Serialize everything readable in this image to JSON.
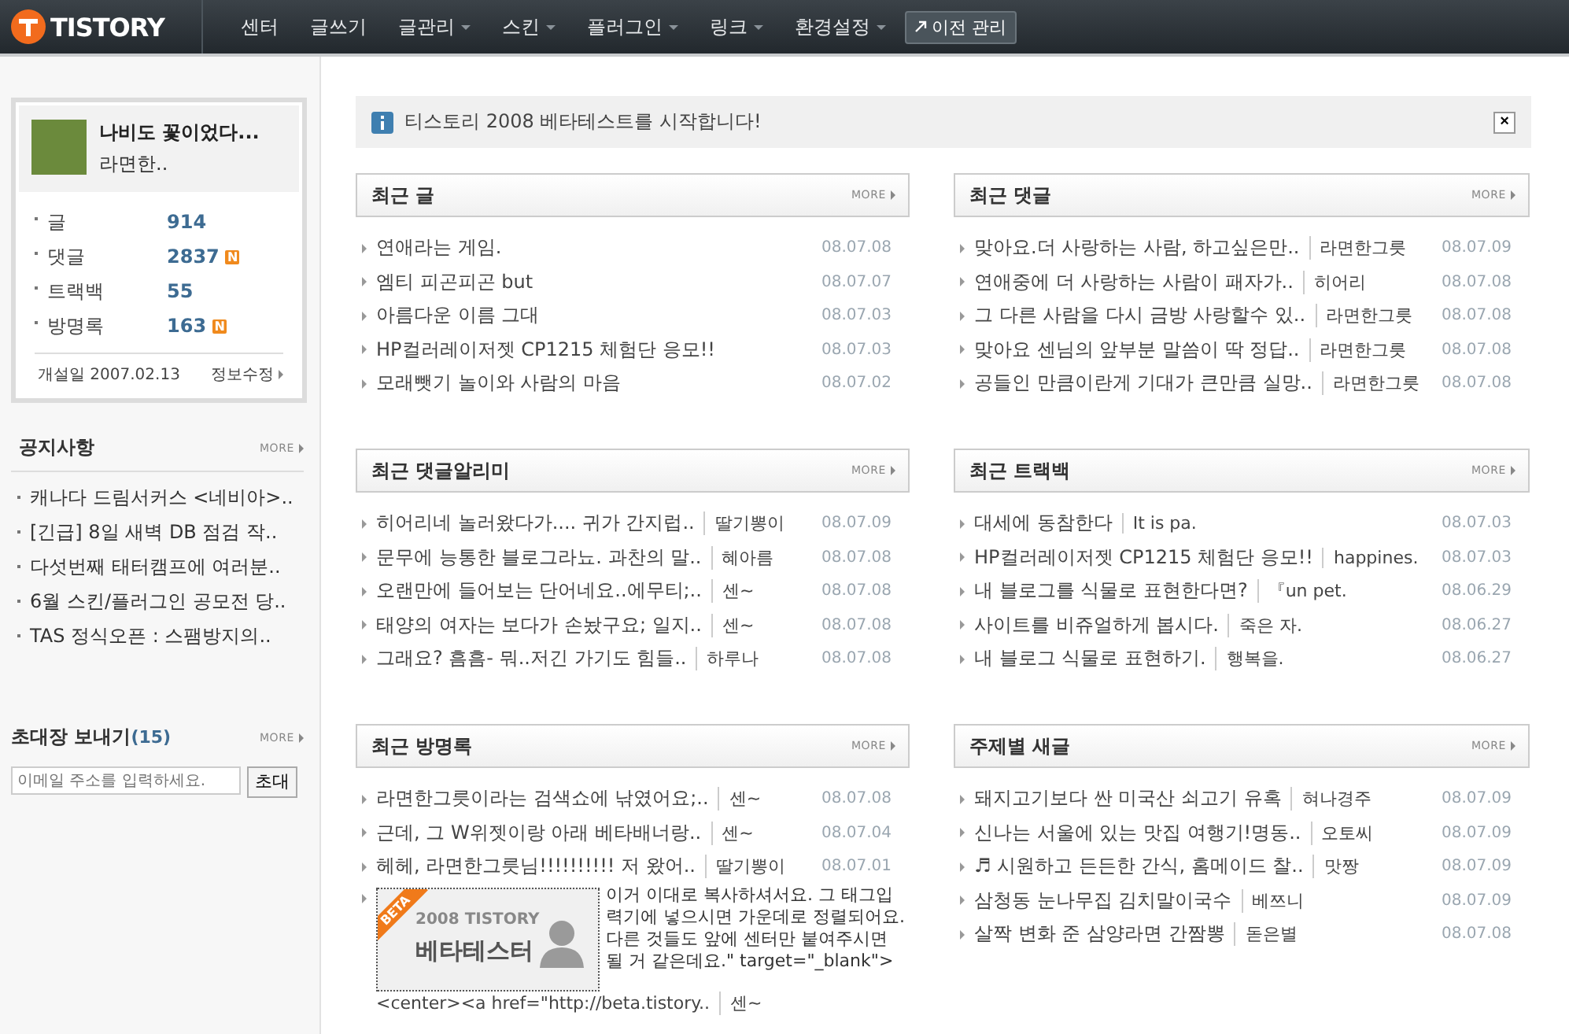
{
  "topbar": {
    "logo": "TISTORY",
    "nav": [
      {
        "label": "센터",
        "dropdown": false
      },
      {
        "label": "글쓰기",
        "dropdown": false
      },
      {
        "label": "글관리",
        "dropdown": true
      },
      {
        "label": "스킨",
        "dropdown": true
      },
      {
        "label": "플러그인",
        "dropdown": true
      },
      {
        "label": "링크",
        "dropdown": true
      },
      {
        "label": "환경설정",
        "dropdown": true
      }
    ],
    "old_admin_button": "이전 관리"
  },
  "sidebar": {
    "profile": {
      "title": "나비도 꽃이었다...",
      "name": "라면한..",
      "stats": [
        {
          "label": "글",
          "value": "914"
        },
        {
          "label": "댓글",
          "value": "2837",
          "badge": "N"
        },
        {
          "label": "트랙백",
          "value": "55"
        },
        {
          "label": "방명록",
          "value": "163",
          "badge": "N"
        }
      ],
      "opened": "개설일 2007.02.13",
      "edit_link": "정보수정"
    },
    "notices": {
      "title": "공지사항",
      "more": "MORE",
      "items": [
        "캐나다 드림서커스 <네비아>..",
        "[긴급] 8일 새벽 DB 점검 작..",
        "다섯번째 태터캠프에 여러분..",
        "6월 스킨/플러그인 공모전 당..",
        "TAS 정식오픈 : 스팸방지의.."
      ]
    },
    "invite": {
      "title": "초대장 보내기",
      "count": "(15)",
      "more": "MORE",
      "placeholder": "이메일 주소를 입력하세요.",
      "button": "초대"
    }
  },
  "notice_bar": {
    "text": "티스토리 2008 베타테스트를 시작합니다!",
    "close": "×"
  },
  "panels": [
    {
      "title": "최근 글",
      "more": "MORE",
      "rows": [
        {
          "kind": "plain",
          "text": "연애라는 게임.",
          "date": "08.07.08"
        },
        {
          "kind": "plain",
          "text": "엠티 피곤피곤 but",
          "date": "08.07.07"
        },
        {
          "kind": "plain",
          "text": "아름다운 이름 그대",
          "date": "08.07.03"
        },
        {
          "kind": "plain",
          "text": "HP컬러레이저젯 CP1215 체험단 응모!!",
          "date": "08.07.03"
        },
        {
          "kind": "plain",
          "text": "모래뺏기 놀이와 사람의 마음",
          "date": "08.07.02"
        }
      ]
    },
    {
      "title": "최근 댓글",
      "more": "MORE",
      "rows": [
        {
          "kind": "plain",
          "text": "맞아요.더 사랑하는 사람, 하고싶은만..",
          "author": "라면한그릇",
          "date": "08.07.09"
        },
        {
          "kind": "plain",
          "text": "연애중에 더 사랑하는 사람이 패자가..",
          "author": "히어리",
          "date": "08.07.08"
        },
        {
          "kind": "plain",
          "text": "그 다른 사람을 다시 금방 사랑할수 있..",
          "author": "라면한그릇",
          "date": "08.07.08"
        },
        {
          "kind": "plain",
          "text": "맞아요 센님의 앞부분 말씀이 딱 정답..",
          "author": "라면한그릇",
          "date": "08.07.08"
        },
        {
          "kind": "plain",
          "text": "공들인 만큼이란게 기대가 큰만큼 실망..",
          "author": "라면한그릇",
          "date": "08.07.08"
        }
      ]
    },
    {
      "title": "최근 댓글알리미",
      "more": "MORE",
      "rows": [
        {
          "kind": "plain",
          "text": "히어리네 놀러왔다가.... 귀가 간지럽..",
          "author": "딸기뽕이",
          "date": "08.07.09"
        },
        {
          "kind": "plain",
          "text": "문무에 능통한 블로그라뇨. 과찬의 말..",
          "author": "혜아름",
          "date": "08.07.08"
        },
        {
          "kind": "plain",
          "text": "오랜만에 들어보는 단어네요..에무티;..",
          "author": "센~",
          "date": "08.07.08"
        },
        {
          "kind": "plain",
          "text": "태양의 여자는 보다가 손놨구요; 일지..",
          "author": "센~",
          "date": "08.07.08"
        },
        {
          "kind": "plain",
          "text": "그래요? 흠흠- 뭐..저긴 가기도 힘들..",
          "author": "하루나",
          "date": "08.07.08"
        }
      ]
    },
    {
      "title": "최근 트랙백",
      "more": "MORE",
      "rows": [
        {
          "kind": "plain",
          "text": "대세에 동참한다",
          "author": "It is pa.",
          "date": "08.07.03"
        },
        {
          "kind": "plain",
          "text": "HP컬러레이저젯 CP1215 체험단 응모!!",
          "author": "happines.",
          "date": "08.07.03"
        },
        {
          "kind": "plain",
          "text": "내 블로그를 식물로 표현한다면?",
          "author": "『un pet.",
          "date": "08.06.29"
        },
        {
          "kind": "plain",
          "text": "사이트를 비쥬얼하게 봅시다.",
          "author": "죽은 자.",
          "date": "08.06.27"
        },
        {
          "kind": "plain",
          "text": "내 블로그 식물로 표현하기.",
          "author": "행복을.",
          "date": "08.06.27"
        }
      ]
    },
    {
      "title": "최근 방명록",
      "more": "MORE",
      "rows": [
        {
          "kind": "plain",
          "text": "라면한그릇이라는 검색쇼에 낚였어요;..",
          "author": "센~",
          "date": "08.07.08"
        },
        {
          "kind": "plain",
          "text": "근데, 그 W위젯이랑 아래 베타배너랑..",
          "author": "센~",
          "date": "08.07.04"
        },
        {
          "kind": "plain",
          "text": "헤헤, 라면한그릇님!!!!!!!!!! 저 왔어..",
          "author": "딸기뽕이",
          "date": "08.07.01"
        },
        {
          "kind": "banner",
          "banner": {
            "ribbon": "BETA",
            "line1": "2008 TISTORY",
            "line2": "베타테스터"
          },
          "text": "이거 이대로 복사하셔서요. 그 태그입력기에 넣으시면 가운데로 정렬되어요. 다른 것들도 앞에 센터만 붙여주시면 될 거 같은데요.\" target=\"_blank\">",
          "text_below": "<center><a href=\"http://beta.tistory..",
          "author": "센~"
        }
      ]
    },
    {
      "title": "주제별 새글",
      "more": "MORE",
      "rows": [
        {
          "kind": "plain",
          "text": "돼지고기보다 싼 미국산 쇠고기 유혹",
          "author": "혀나경주",
          "date": "08.07.09"
        },
        {
          "kind": "plain",
          "text": "신나는 서울에 있는 맛집 여행기!명동..",
          "author": "오토씨",
          "date": "08.07.09"
        },
        {
          "kind": "plain",
          "text": "♬ 시원하고 든든한 간식, 홈메이드 찰..",
          "author": "맛짱",
          "date": "08.07.09"
        },
        {
          "kind": "plain",
          "text": "삼청동 눈나무집 김치말이국수",
          "author": "베쯔니",
          "date": "08.07.09"
        },
        {
          "kind": "plain",
          "text": "살짝 변화 준 삼양라면 간짬뽕",
          "author": "돋은별",
          "date": "08.07.08"
        }
      ]
    }
  ]
}
